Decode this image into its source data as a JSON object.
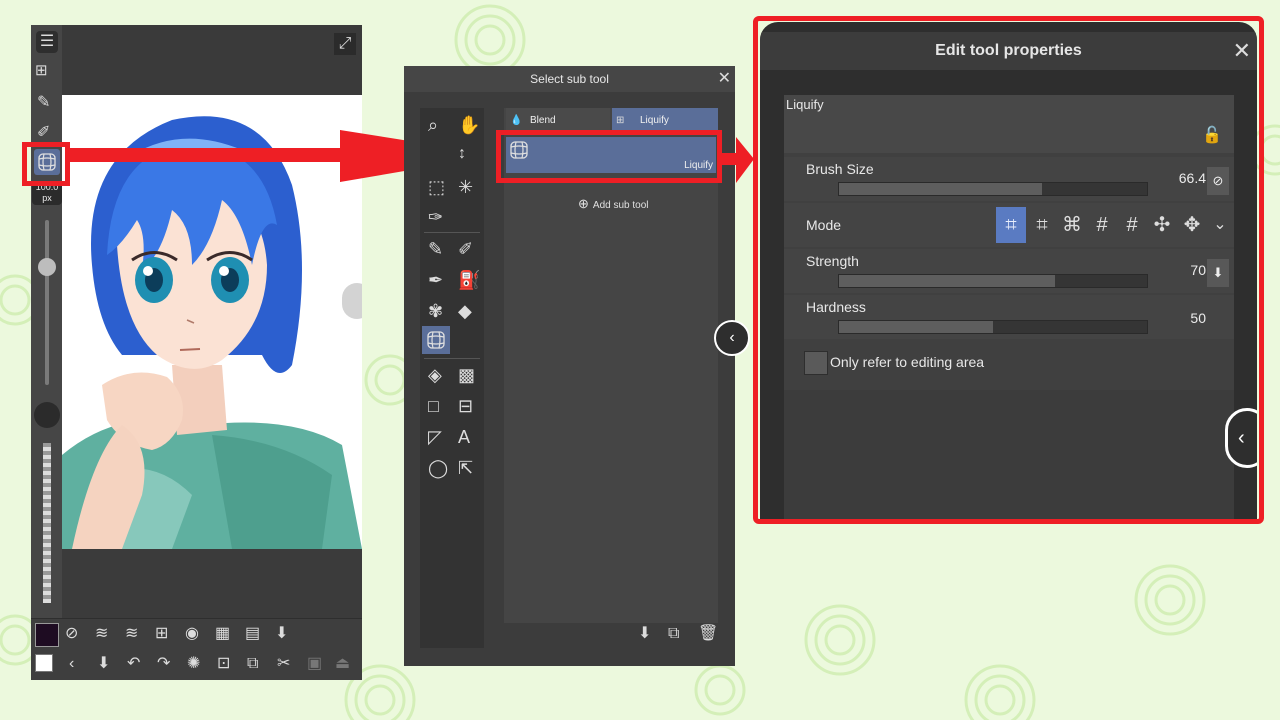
{
  "phone": {
    "brush_size_value": "100.0",
    "brush_size_unit": "px"
  },
  "subtool_panel": {
    "title": "Select sub tool",
    "tabs": [
      "Blend",
      "Liquify"
    ],
    "selected_subtool_label": "Liquify",
    "add_subtool_label": "Add sub tool"
  },
  "props_panel": {
    "title": "Edit tool properties",
    "section_title": "Liquify",
    "rows": {
      "brush_size": {
        "label": "Brush Size",
        "value": "66.4",
        "fraction": 0.66
      },
      "mode": {
        "label": "Mode"
      },
      "strength": {
        "label": "Strength",
        "value": "70",
        "fraction": 0.7
      },
      "hardness": {
        "label": "Hardness",
        "value": "50",
        "fraction": 0.5
      }
    },
    "checkbox_label": "Only refer to editing area"
  },
  "colors": {
    "highlight_red": "#ee1f25",
    "selected_blue": "#5a6e99",
    "panel_dark": "#3c3c3c",
    "background_green": "#ecf9dd"
  }
}
